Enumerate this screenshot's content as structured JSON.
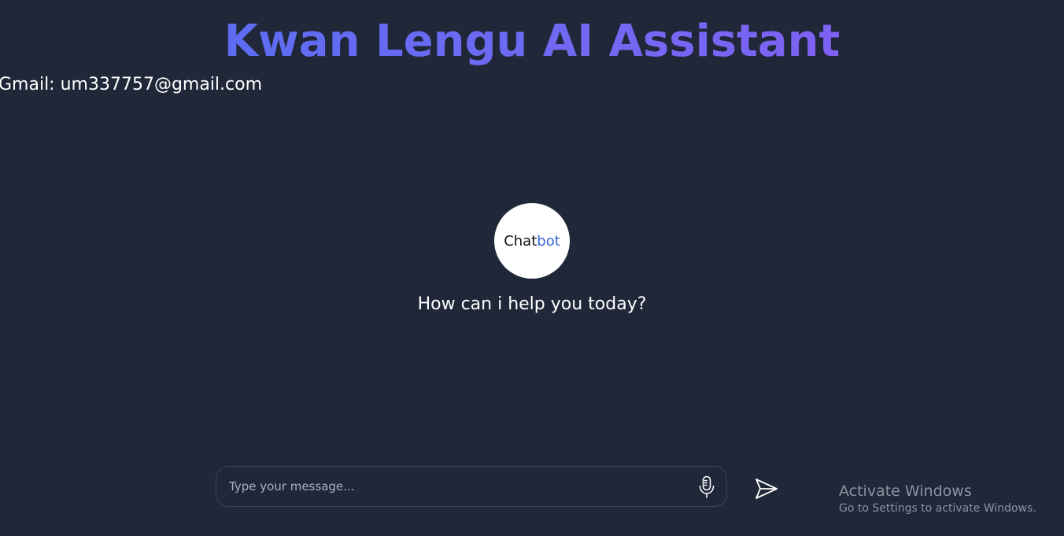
{
  "header": {
    "title": "Kwan Lengu AI Assistant",
    "title_gradient": [
      "#4f6ff2",
      "#6f69f2",
      "#8b5cf6"
    ]
  },
  "contact": {
    "text": "Gmail: um337757@gmail.com"
  },
  "avatar": {
    "label_part1": "Chat",
    "label_part2": "bot",
    "accent_color": "#3568d4"
  },
  "greeting": {
    "text": "How can i help you today?"
  },
  "composer": {
    "placeholder": "Type your message...",
    "value": "",
    "mic_icon": "microphone-icon",
    "send_icon": "send-icon"
  },
  "watermark": {
    "title": "Activate Windows",
    "subtitle": "Go to Settings to activate Windows."
  },
  "colors": {
    "background": "#1f2738",
    "text": "#ffffff"
  }
}
